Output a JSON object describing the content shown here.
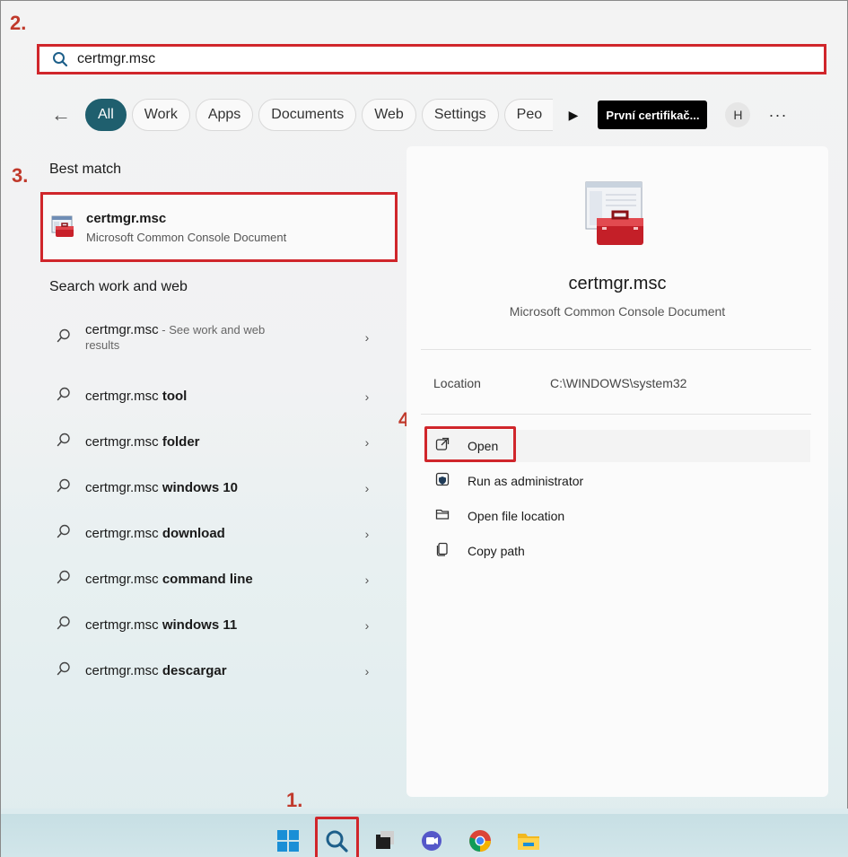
{
  "steps": [
    "1.",
    "2.",
    "3.",
    "4."
  ],
  "search": {
    "value": "certmgr.msc"
  },
  "filters": {
    "back": "←",
    "items": [
      "All",
      "Work",
      "Apps",
      "Documents",
      "Web",
      "Settings",
      "Peo"
    ],
    "more_arrow": "▶",
    "tooltip": "První certifikač...",
    "avatar": "H",
    "overflow": "···"
  },
  "best_match": {
    "heading": "Best match",
    "title": "certmgr.msc",
    "subtitle": "Microsoft Common Console Document"
  },
  "search_web": {
    "heading": "Search work and web",
    "first": {
      "prefix": "certmgr.msc",
      "suffix": " - See work and web",
      "sub": "results"
    },
    "items": [
      {
        "prefix": "certmgr.msc ",
        "bold": "tool"
      },
      {
        "prefix": "certmgr.msc ",
        "bold": "folder"
      },
      {
        "prefix": "certmgr.msc ",
        "bold": "windows 10"
      },
      {
        "prefix": "certmgr.msc ",
        "bold": "download"
      },
      {
        "prefix": "certmgr.msc ",
        "bold": "command line"
      },
      {
        "prefix": "certmgr.msc ",
        "bold": "windows 11"
      },
      {
        "prefix": "certmgr.msc ",
        "bold": "descargar"
      }
    ],
    "chevron": "›"
  },
  "details": {
    "title": "certmgr.msc",
    "subtitle": "Microsoft Common Console Document",
    "location_label": "Location",
    "location_value": "C:\\WINDOWS\\system32",
    "actions": [
      "Open",
      "Run as administrator",
      "Open file location",
      "Copy path"
    ]
  },
  "colors": {
    "accent": "#1f5f6e",
    "highlight_red": "#d0262b",
    "step_red": "#c0392b"
  }
}
